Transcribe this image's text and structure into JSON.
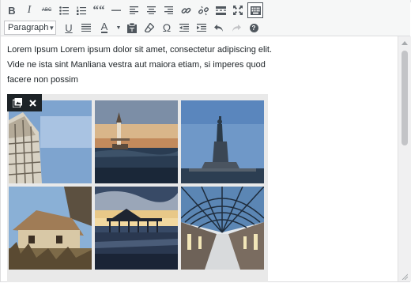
{
  "toolbar": {
    "row1": [
      "bold-button",
      "italic-button",
      "strikethrough-button",
      "bulleted-list-button",
      "numbered-list-button",
      "blockquote-button",
      "horizontal-line-button",
      "align-left-button",
      "align-center-button",
      "align-right-button",
      "insert-link-button",
      "remove-link-button",
      "read-more-button",
      "fullscreen-button",
      "toolbar-toggle-button"
    ],
    "format_select": {
      "value": "Paragraph"
    },
    "bold_label": "B",
    "italic_label": "I",
    "strike_label": "ABC",
    "quote_label": "““",
    "underline_label": "U",
    "textcolor_label": "A",
    "omega_label": "Ω",
    "help_label": "?"
  },
  "content": {
    "paragraph_lines": [
      "Lorem Ipsum Lorem ipsum dolor sit amet, consectetur adipiscing elit.",
      "Vide ne ista sint Manliana vestra aut maiora etiam, si imperes quod",
      "facere non possim"
    ]
  },
  "gallery": {
    "images": [
      "leaning-tower",
      "sunset-lighthouse",
      "statue-of-liberty",
      "thatched-cottage",
      "pier-sunset",
      "glass-arcade"
    ]
  },
  "colors": {
    "toolbar_bg": "#f6f7f7",
    "border": "#dcdcde",
    "icon": "#50575e",
    "text": "#1d2327"
  }
}
